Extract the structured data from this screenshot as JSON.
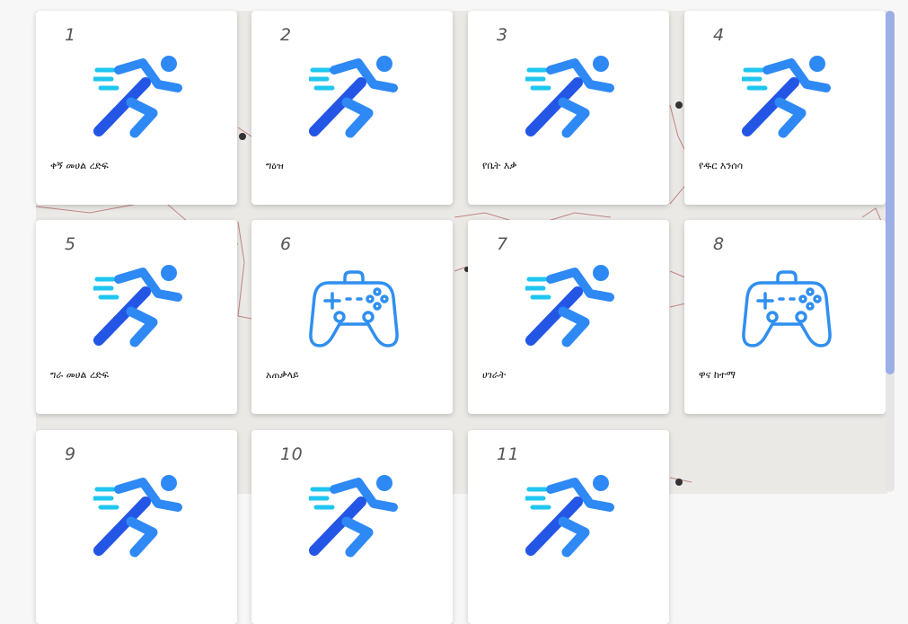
{
  "colors": {
    "runner_light": "#1fc6ef",
    "runner_blue": "#2e89f5",
    "runner_dark": "#2456e6",
    "gamepad": "#2f8ff0",
    "scrollbar_thumb": "#9caee6"
  },
  "cards": [
    {
      "number": "1",
      "label": "ቀኝ መሀል ረድፍ",
      "icon": "runner-icon"
    },
    {
      "number": "2",
      "label": "ግዕዝ",
      "icon": "runner-icon"
    },
    {
      "number": "3",
      "label": "የቤት እቃ",
      "icon": "runner-icon"
    },
    {
      "number": "4",
      "label": "የዱር እንሰሳ",
      "icon": "runner-icon"
    },
    {
      "number": "5",
      "label": "ግራ መሀል ረድፍ",
      "icon": "runner-icon"
    },
    {
      "number": "6",
      "label": "አጠቃላይ",
      "icon": "gamepad-icon"
    },
    {
      "number": "7",
      "label": "ሀገራት",
      "icon": "runner-icon"
    },
    {
      "number": "8",
      "label": "ዋና ከተማ",
      "icon": "gamepad-icon"
    },
    {
      "number": "9",
      "label": "",
      "icon": "runner-icon"
    },
    {
      "number": "10",
      "label": "",
      "icon": "runner-icon"
    },
    {
      "number": "11",
      "label": "",
      "icon": "runner-icon"
    }
  ]
}
